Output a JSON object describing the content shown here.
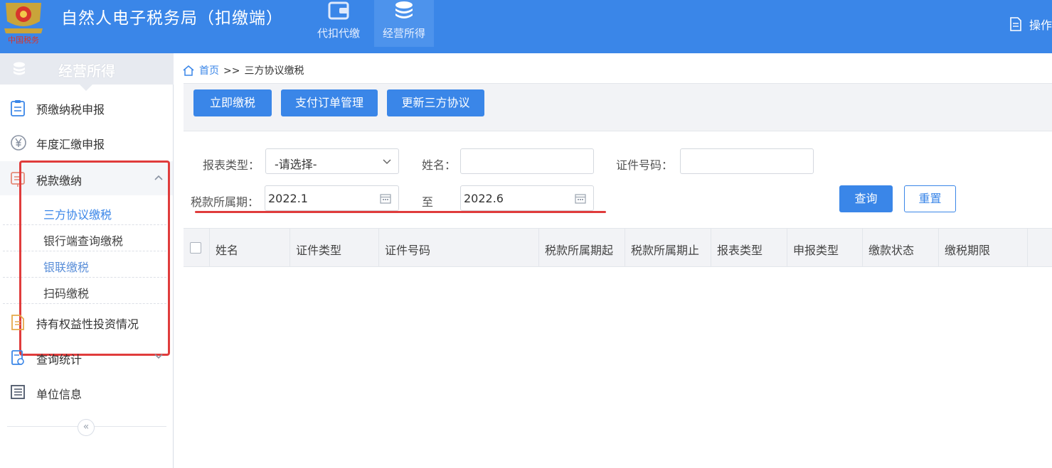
{
  "header": {
    "title": "自然人电子税务局（扣缴端）",
    "emblem_text": "中国税务",
    "tabs": [
      {
        "label": "代扣代缴",
        "icon": "wallet-icon",
        "active": false
      },
      {
        "label": "经营所得",
        "icon": "coin-stack-icon",
        "active": true
      }
    ],
    "op_label": "操作"
  },
  "sidebar": {
    "heading": "经营所得",
    "items": [
      {
        "label": "预缴纳税申报",
        "icon": "clipboard-icon"
      },
      {
        "label": "年度汇缴申报",
        "icon": "yen-icon"
      },
      {
        "label": "税款缴纳",
        "icon": "receipt-icon",
        "expanded": true
      },
      {
        "label": "持有权益性投资情况",
        "icon": "document-icon"
      },
      {
        "label": "查询统计",
        "icon": "report-icon"
      },
      {
        "label": "单位信息",
        "icon": "list-icon"
      }
    ],
    "sub_items": [
      {
        "label": "三方协议缴税",
        "active": true
      },
      {
        "label": "银行端查询缴税"
      },
      {
        "label": "银联缴税",
        "link": true
      },
      {
        "label": "扫码缴税"
      }
    ],
    "collapse_glyph": "«"
  },
  "breadcrumb": {
    "home": "首页",
    "sep": ">>",
    "current": "三方协议缴税"
  },
  "toolbar": {
    "pay_now": "立即缴税",
    "order_manage": "支付订单管理",
    "update_agreement": "更新三方协议"
  },
  "filters": {
    "report_type_label": "报表类型：",
    "report_type_value": "-请选择-",
    "name_label": "姓名：",
    "name_value": "",
    "id_label": "证件号码：",
    "id_value": "",
    "period_label": "税款所属期：",
    "period_from": "2022.1",
    "to_label": "至",
    "period_to": "2022.6",
    "query": "查询",
    "reset": "重置"
  },
  "grid": {
    "columns": [
      "姓名",
      "证件类型",
      "证件号码",
      "税款所属期起",
      "税款所属期止",
      "报表类型",
      "申报类型",
      "缴款状态",
      "缴税期限"
    ],
    "rows": []
  },
  "colors": {
    "brand": "#3a86e8",
    "highlight": "#e03c3c"
  }
}
